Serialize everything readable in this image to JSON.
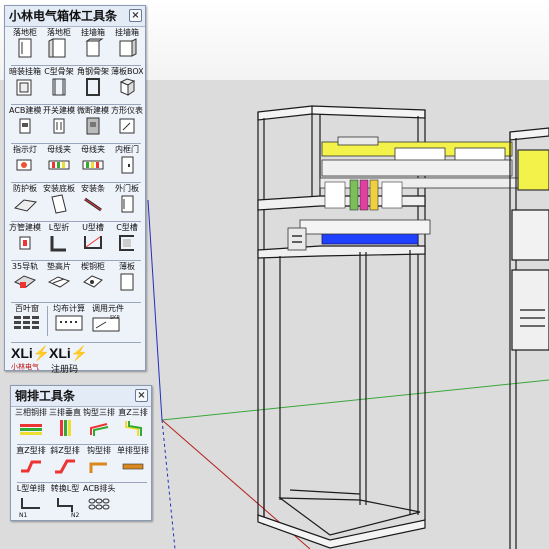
{
  "toolbar1": {
    "title": "小林电气箱体工具条",
    "close": "×",
    "items": [
      {
        "label": "落地柜",
        "icon": "floor-cabinet-icon"
      },
      {
        "label": "落地柜",
        "icon": "floor-cabinet-open-icon"
      },
      {
        "label": "挂墙箱",
        "icon": "wall-box-icon"
      },
      {
        "label": "挂墙箱",
        "icon": "wall-box-open-icon"
      },
      {
        "label": "暗装挂箱",
        "icon": "flush-box-icon"
      },
      {
        "label": "C型骨架",
        "icon": "c-frame-icon"
      },
      {
        "label": "角钢骨架",
        "icon": "angle-frame-icon"
      },
      {
        "label": "薄板BOX",
        "icon": "thin-box-icon"
      },
      {
        "label": "ACB建模",
        "icon": "acb-icon"
      },
      {
        "label": "开关建模",
        "icon": "switch-icon"
      },
      {
        "label": "微断建模",
        "icon": "mcb-icon"
      },
      {
        "label": "方形仪表",
        "icon": "meter-icon"
      },
      {
        "label": "指示灯",
        "icon": "indicator-icon"
      },
      {
        "label": "母线夹",
        "icon": "busbar-clamp-icon"
      },
      {
        "label": "母线夹",
        "icon": "busbar-clamp-2-icon"
      },
      {
        "label": "内框门",
        "icon": "inner-door-icon"
      },
      {
        "label": "防护板",
        "icon": "guard-plate-icon"
      },
      {
        "label": "安装底板",
        "icon": "mounting-plate-icon"
      },
      {
        "label": "安装条",
        "icon": "mounting-strip-icon"
      },
      {
        "label": "外门板",
        "icon": "outer-door-icon"
      },
      {
        "label": "方管建模",
        "icon": "square-tube-icon"
      },
      {
        "label": "L型折",
        "icon": "l-bend-icon"
      },
      {
        "label": "U型槽",
        "icon": "u-channel-icon"
      },
      {
        "label": "C型槽",
        "icon": "c-channel-icon"
      },
      {
        "label": "35导轨",
        "icon": "din-rail-icon"
      },
      {
        "label": "垫高片",
        "icon": "spacer-icon"
      },
      {
        "label": "楔铜柜",
        "icon": "copper-cabinet-icon"
      },
      {
        "label": "薄板",
        "icon": "thin-plate-icon"
      }
    ],
    "bottom": {
      "vent": {
        "label": "百叶窗",
        "icon": "louver-icon"
      },
      "layout": {
        "label": "均布计算",
        "icon": "distribute-icon"
      },
      "adjust": {
        "label": "调用元件",
        "icon": "component-icon",
        "sub": "SKP"
      }
    },
    "logo": {
      "brand1": "XLi",
      "brand2": "XLi",
      "caption1": "小林电气",
      "caption2": "注册码"
    }
  },
  "toolbar2": {
    "title": "铜排工具条",
    "close": "×",
    "items": [
      {
        "label": "三相铜排",
        "icon": "three-phase-busbar-icon"
      },
      {
        "label": "三排垂直",
        "icon": "vertical-busbar-icon"
      },
      {
        "label": "钩型三排",
        "icon": "hook-busbar-icon"
      },
      {
        "label": "直Z三排",
        "icon": "z-busbar-icon"
      },
      {
        "label": "直Z型排",
        "icon": "z-bar-icon"
      },
      {
        "label": "斜Z型排",
        "icon": "oblique-z-bar-icon"
      },
      {
        "label": "钩型排",
        "icon": "hook-bar-icon"
      },
      {
        "label": "单排型排",
        "icon": "single-bar-icon"
      },
      {
        "label": "L型单排",
        "icon": "l-single-bar-icon",
        "sub": "N1"
      },
      {
        "label": "转换L型",
        "icon": "convert-l-icon",
        "sub": "N2"
      },
      {
        "label": "ACB排头",
        "icon": "acb-head-icon"
      }
    ]
  }
}
